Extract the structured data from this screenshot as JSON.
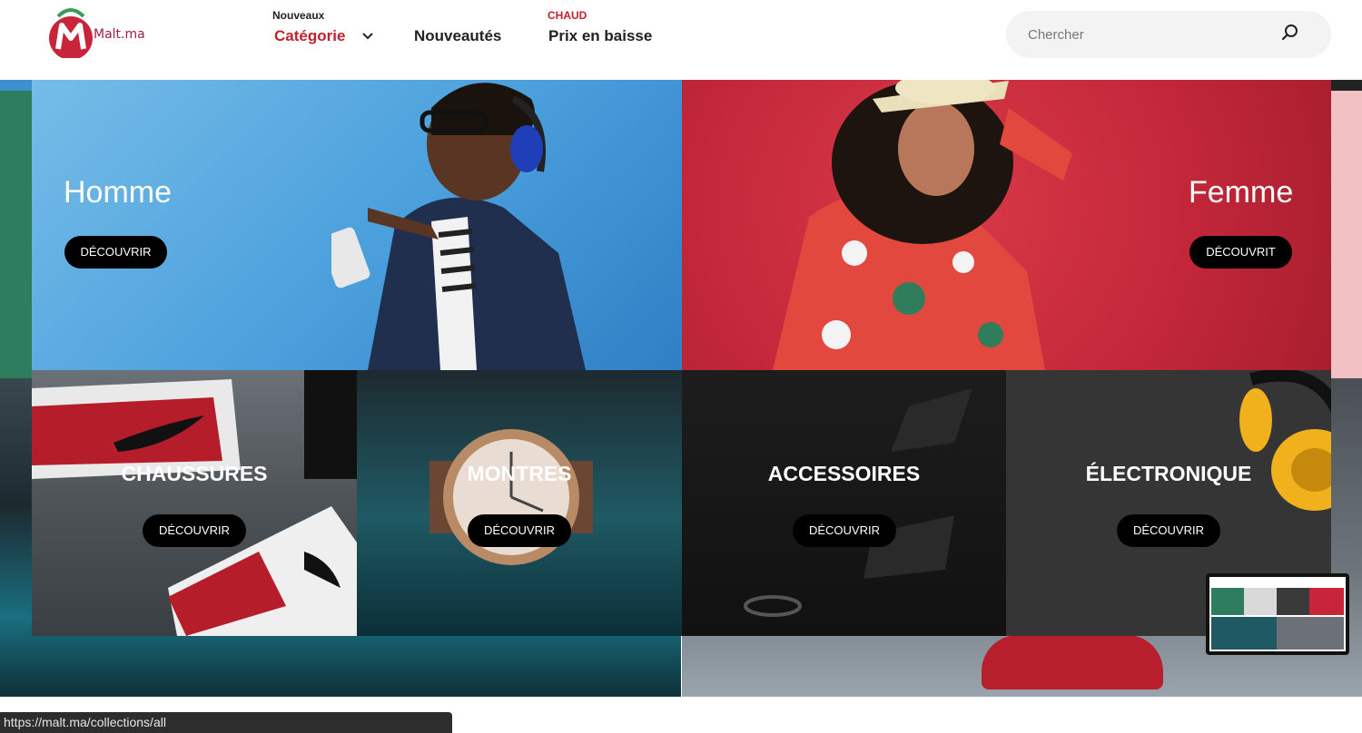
{
  "header": {
    "logo_text": "Malt.ma",
    "nav": [
      {
        "small": "Nouveaux",
        "label": "Catégorie"
      },
      {
        "small": "",
        "label": "Nouveautés"
      },
      {
        "small": "CHAUD",
        "label": "Prix en baisse"
      }
    ],
    "search": {
      "placeholder": "Chercher"
    }
  },
  "menu": {
    "homme": {
      "title": "Homme",
      "button": "DÉCOUVRIR"
    },
    "femme": {
      "title": "Femme",
      "button": "DÉCOUVRIT"
    },
    "chaussures": {
      "title": "CHAUSSURES",
      "button": "DÉCOUVRIR"
    },
    "montres": {
      "title": "MONTRES",
      "button": "DÉCOUVRIR"
    },
    "accessoires": {
      "title": "ACCESSOIRES",
      "button": "DÉCOUVRIR"
    },
    "electronique": {
      "title": "ÉLECTRONIQUE",
      "button": "DÉCOUVRIR"
    }
  },
  "status_url": "https://malt.ma/collections/all",
  "colors": {
    "accent": "#c0232e",
    "nav_text": "#222222",
    "button_bg": "#000000"
  }
}
